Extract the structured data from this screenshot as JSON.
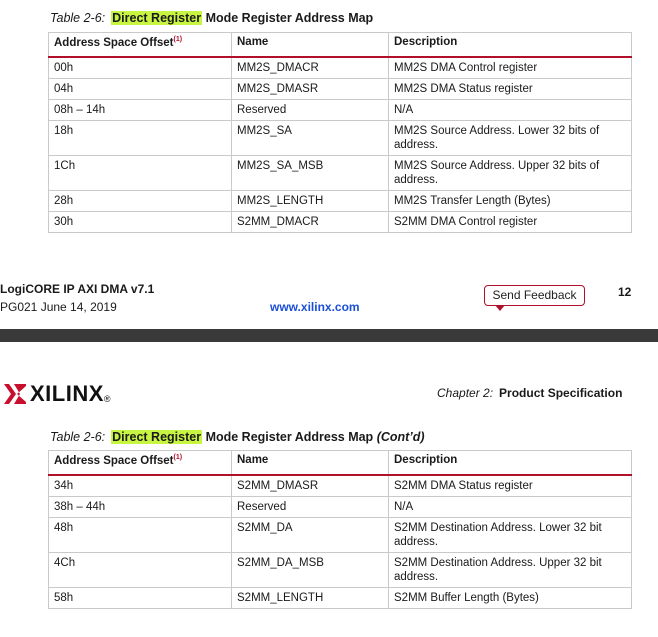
{
  "table1": {
    "caption_num": "Table 2-6:",
    "caption_highlight": "Direct Register",
    "caption_rest": "Mode Register Address Map",
    "headers": [
      "Address Space Offset",
      "Name",
      "Description"
    ],
    "header_note": "(1)",
    "rows": [
      [
        "00h",
        "MM2S_DMACR",
        "MM2S DMA Control register"
      ],
      [
        "04h",
        "MM2S_DMASR",
        "MM2S DMA Status register"
      ],
      [
        "08h – 14h",
        "Reserved",
        "N/A"
      ],
      [
        "18h",
        "MM2S_SA",
        "MM2S Source Address. Lower 32 bits of address."
      ],
      [
        "1Ch",
        "MM2S_SA_MSB",
        "MM2S Source Address. Upper 32 bits of address."
      ],
      [
        "28h",
        "MM2S_LENGTH",
        "MM2S Transfer Length (Bytes)"
      ],
      [
        "30h",
        "S2MM_DMACR",
        "S2MM DMA Control register"
      ]
    ]
  },
  "footer": {
    "title": "LogiCORE IP AXI DMA v7.1",
    "date": "PG021 June 14, 2019",
    "link": "www.xilinx.com",
    "feedback": "Send Feedback",
    "page": "12"
  },
  "header": {
    "logo": "XILINX",
    "logo_mark": "®",
    "chapter_num": "Chapter 2:",
    "chapter_title": "Product Specification"
  },
  "table2": {
    "caption_num": "Table 2-6:",
    "caption_highlight": "Direct Register",
    "caption_rest": "Mode Register Address Map",
    "caption_contd": "(Cont’d)",
    "headers": [
      "Address Space Offset",
      "Name",
      "Description"
    ],
    "header_note": "(1)",
    "rows": [
      [
        "34h",
        "S2MM_DMASR",
        "S2MM DMA Status register"
      ],
      [
        "38h – 44h",
        "Reserved",
        "N/A"
      ],
      [
        "48h",
        "S2MM_DA",
        "S2MM Destination Address. Lower 32 bit address."
      ],
      [
        "4Ch",
        "S2MM_DA_MSB",
        "S2MM Destination Address. Upper 32 bit address."
      ],
      [
        "58h",
        "S2MM_LENGTH",
        "S2MM Buffer Length (Bytes)"
      ]
    ]
  }
}
